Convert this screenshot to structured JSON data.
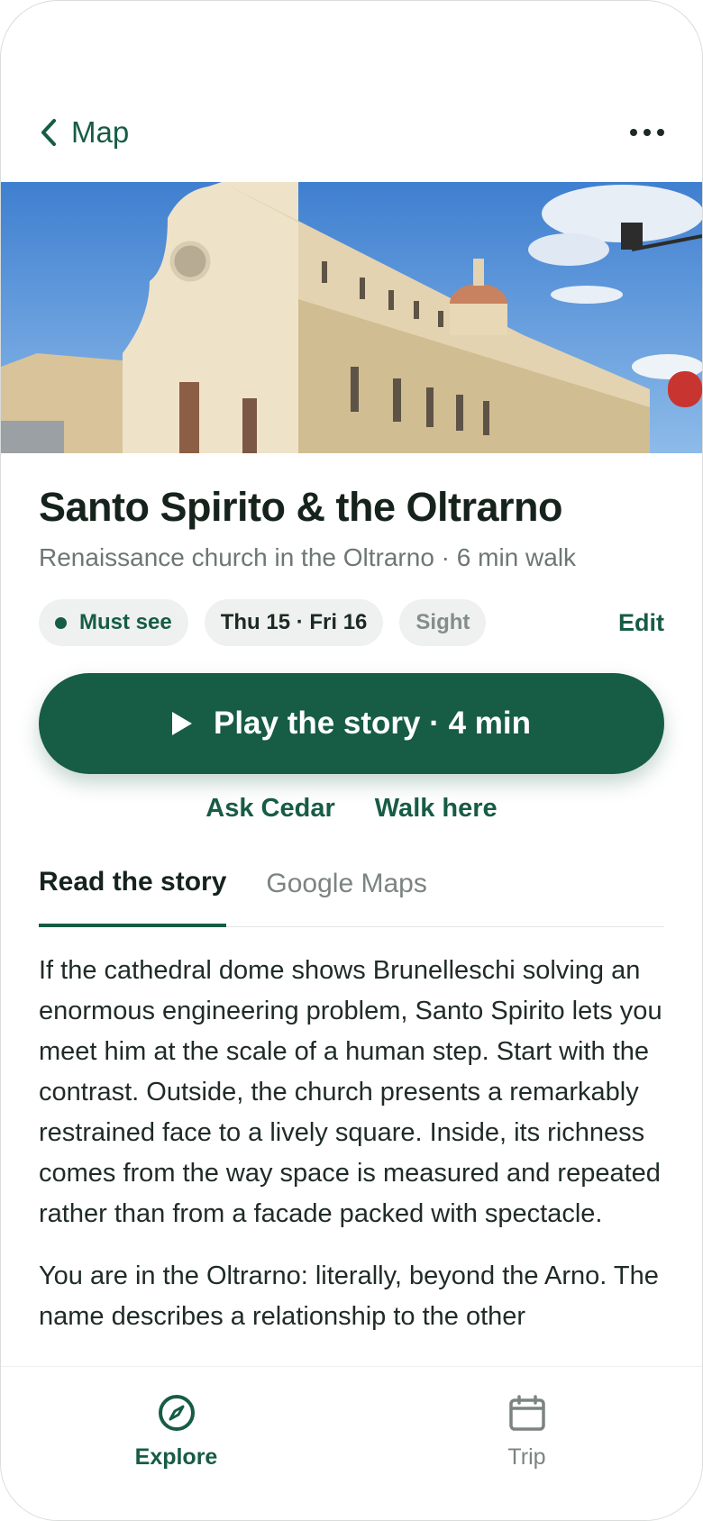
{
  "nav": {
    "back_label": "Map"
  },
  "place": {
    "title": "Santo Spirito & the Oltrarno",
    "subtitle": "Renaissance church in the Oltrarno · 6 min walk"
  },
  "chips": {
    "must_see": "Must see",
    "dates": "Thu 15 · Fri 16",
    "category": "Sight",
    "edit": "Edit"
  },
  "actions": {
    "play": "Play the story · 4 min",
    "ask": "Ask Cedar",
    "walk": "Walk here"
  },
  "tabs": {
    "read": "Read the story",
    "maps": "Google Maps"
  },
  "story": {
    "p1": "If the cathedral dome shows Brunelleschi solving an enormous engineering problem, Santo Spirito lets you meet him at the scale of a human step. Start with the contrast. Outside, the church presents a remarkably restrained face to a lively square. Inside, its richness comes from the way space is measured and repeated rather than from a facade packed with spectacle.",
    "p2": "You are in the Oltrarno: literally, beyond the Arno. The name describes a relationship to the other"
  },
  "tabbar": {
    "explore": "Explore",
    "trip": "Trip"
  },
  "colors": {
    "accent": "#175c45",
    "chip_bg": "#eef1ef"
  },
  "icons": [
    "chevron-left-icon",
    "more-icon",
    "play-icon",
    "compass-icon",
    "calendar-icon"
  ]
}
